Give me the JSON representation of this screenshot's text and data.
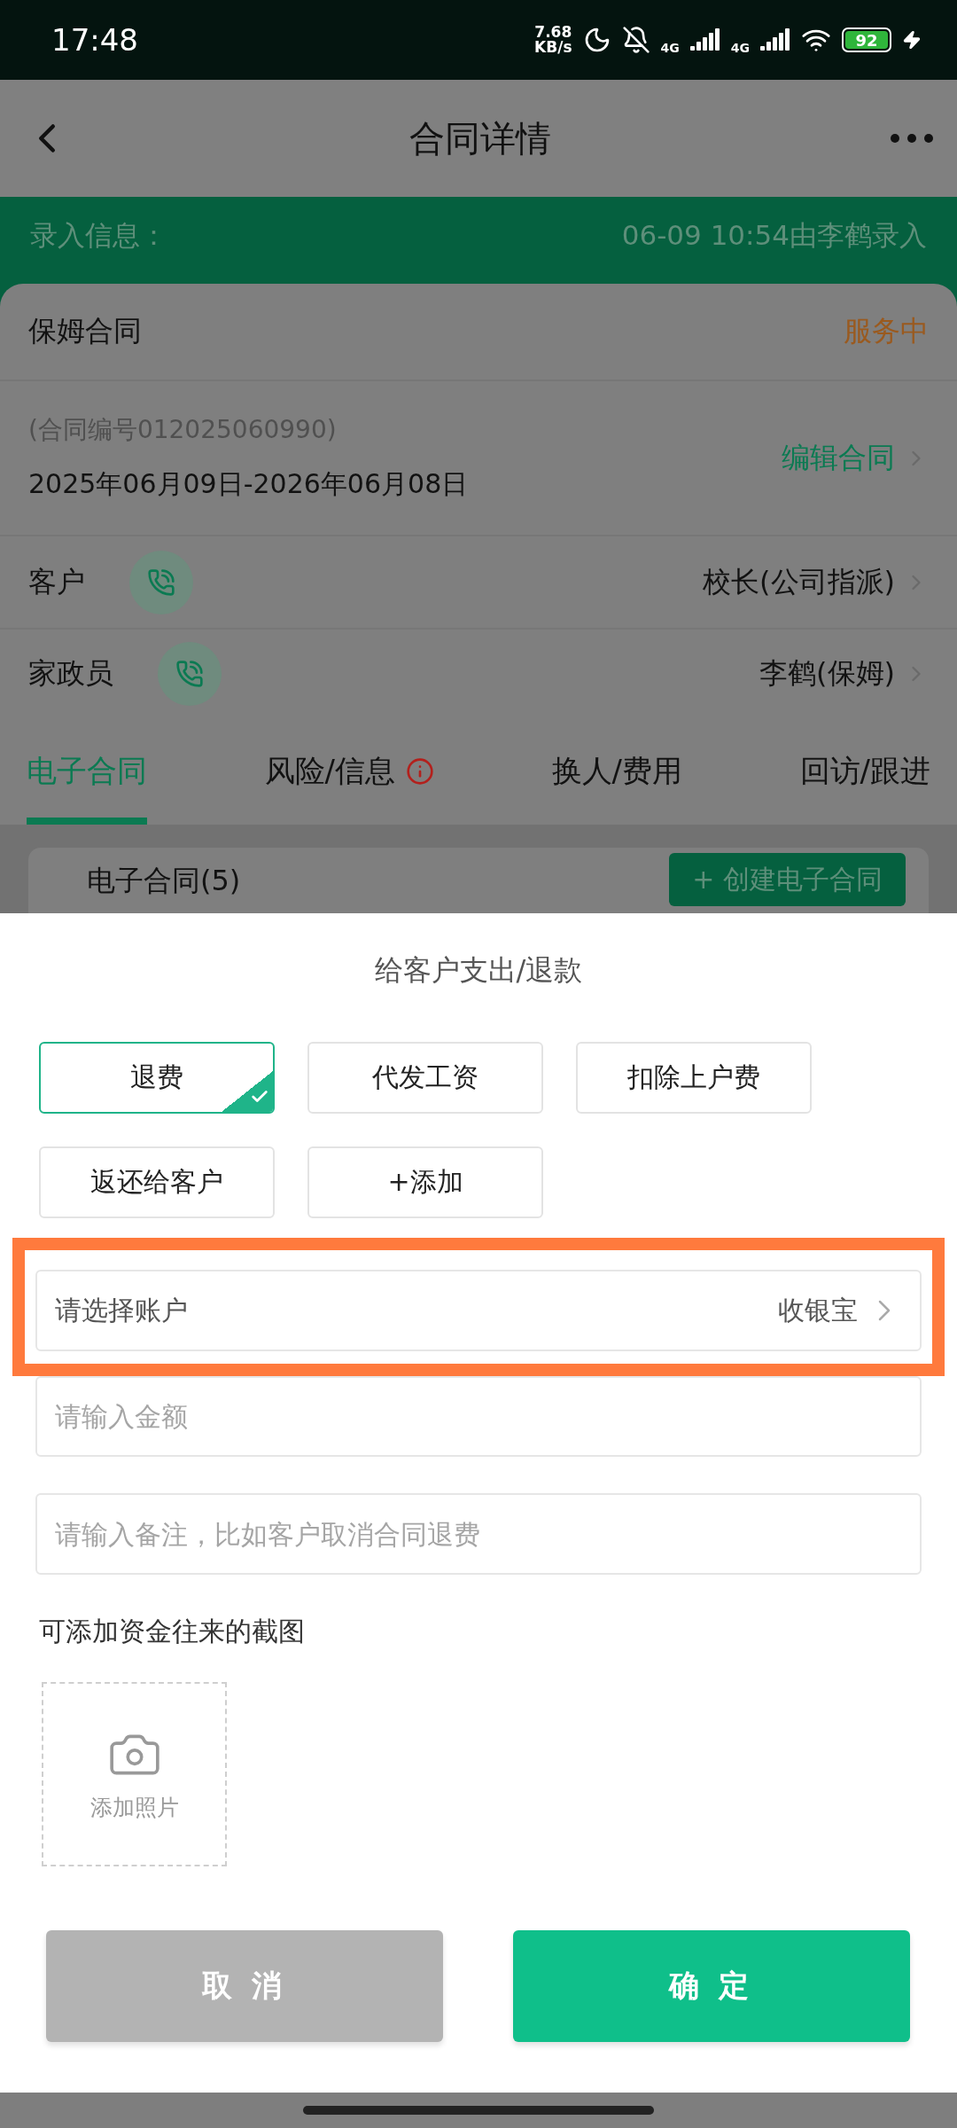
{
  "status_bar": {
    "time": "17:48",
    "speed_value": "7.68",
    "speed_unit": "KB/s",
    "network_1": "4G",
    "network_2": "4G",
    "battery": "92"
  },
  "header": {
    "title": "合同详情"
  },
  "entry_info": {
    "label": "录入信息：",
    "value": "06-09 10:54由李鹤录入"
  },
  "contract": {
    "title": "保姆合同",
    "status": "服务中",
    "number": "(合同编号012025060990)",
    "period": "2025年06月09日-2026年06月08日",
    "edit_link": "编辑合同"
  },
  "parties": [
    {
      "role": "客户",
      "name": "校长(公司指派)"
    },
    {
      "role": "家政员",
      "name": "李鹤(保姆)"
    }
  ],
  "tabs": [
    {
      "label": "电子合同",
      "selected": true,
      "alert": false
    },
    {
      "label": "风险/信息",
      "selected": false,
      "alert": true
    },
    {
      "label": "换人/费用",
      "selected": false,
      "alert": false
    },
    {
      "label": "回访/跟进",
      "selected": false,
      "alert": false
    }
  ],
  "section": {
    "title": "电子合同(5)",
    "button": "+ 创建电子合同"
  },
  "sheet": {
    "title": "给客户支出/退款",
    "options": [
      {
        "label": "退费",
        "selected": true
      },
      {
        "label": "代发工资",
        "selected": false
      },
      {
        "label": "扣除上户费",
        "selected": false
      },
      {
        "label": "返还给客户",
        "selected": false
      },
      {
        "label": "+添加",
        "selected": false
      }
    ],
    "account": {
      "label": "请选择账户",
      "value": "收银宝",
      "highlighted": true
    },
    "amount": {
      "placeholder": "请输入金额"
    },
    "remark": {
      "placeholder": "请输入备注，比如客户取消合同退费"
    },
    "upload_label": "可添加资金往来的截图",
    "add_photo": "添加照片",
    "buttons": [
      {
        "label": "取消",
        "kind": "cancel"
      },
      {
        "label": "确定",
        "kind": "confirm"
      }
    ]
  }
}
